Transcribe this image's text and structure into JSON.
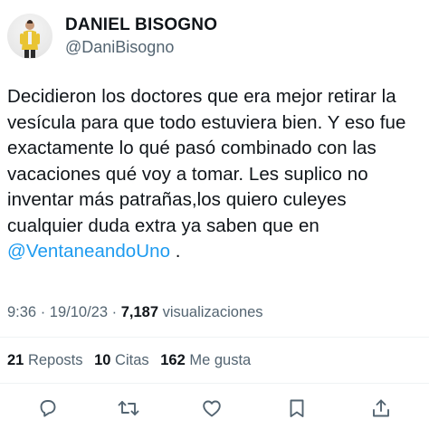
{
  "header": {
    "display_name": "DANIEL BISOGNO",
    "handle": "@DaniBisogno"
  },
  "tweet": {
    "text": "Decidieron los doctores que era mejor retirar la\nvesícula para que todo estuviera bien. Y eso fue\nexactamente lo qué pasó combinado con las\nvacaciones qué voy a tomar. Les suplico no\ninventar más patrañas,los quiero culeyes\ncualquier duda extra ya saben que en\n",
    "mention": "@VentaneandoUno",
    "trailing": " ."
  },
  "meta": {
    "time": "9:36",
    "separator1": " · ",
    "date": "19/10/23",
    "separator2": " · ",
    "views_count": "7,187",
    "views_label": " visualizaciones"
  },
  "stats": {
    "reposts_count": "21",
    "reposts_label": "Reposts",
    "quotes_count": "10",
    "quotes_label": "Citas",
    "likes_count": "162",
    "likes_label": "Me gusta"
  },
  "actions": [
    "reply-icon",
    "repost-icon",
    "like-icon",
    "bookmark-icon",
    "share-icon"
  ],
  "colors": {
    "text": "#0f1419",
    "secondary": "#536471",
    "link": "#1d9bf0",
    "divider": "#eff3f4"
  }
}
